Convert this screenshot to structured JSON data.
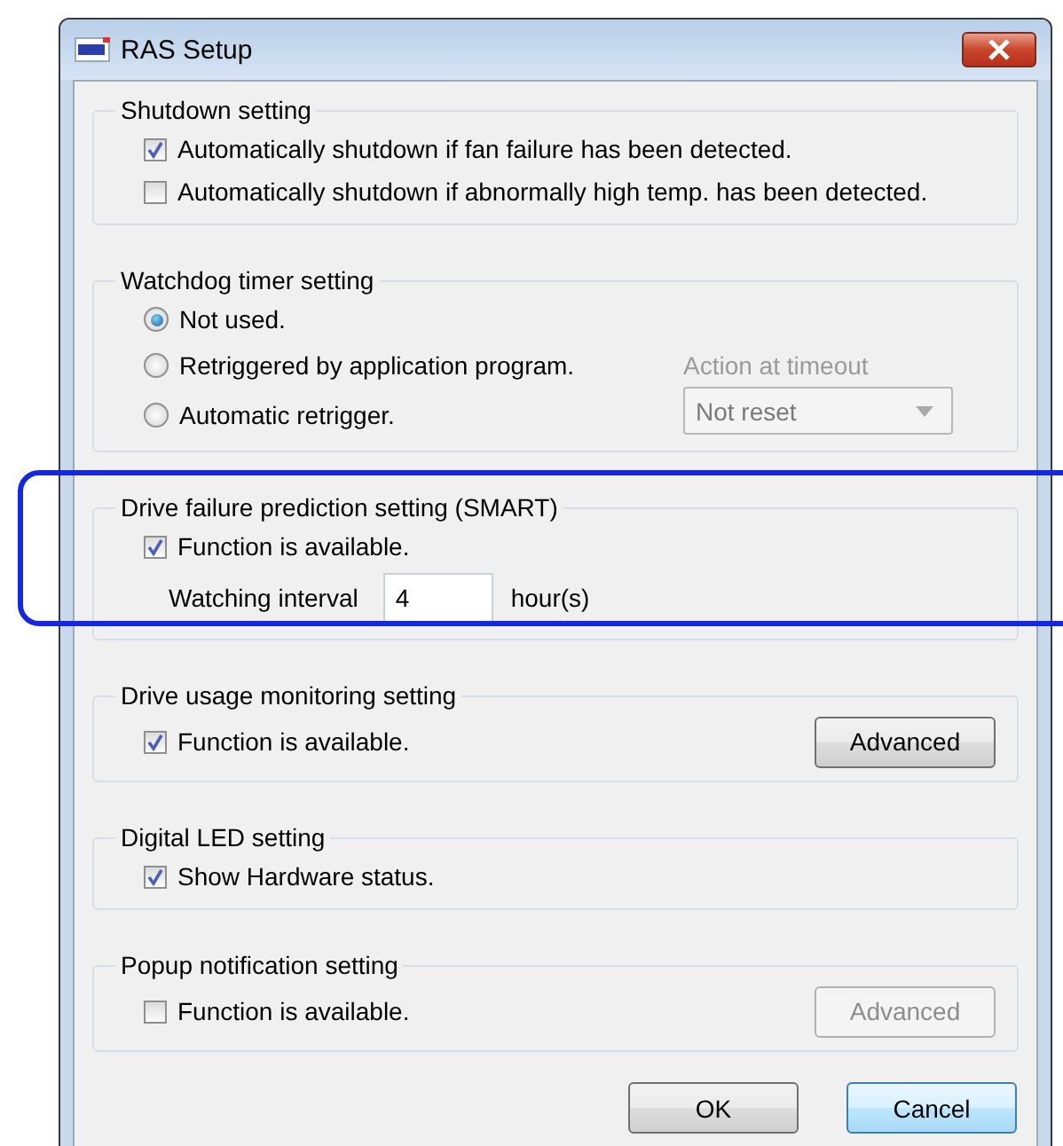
{
  "window": {
    "title": "RAS Setup"
  },
  "shutdown": {
    "title": "Shutdown setting",
    "options": [
      {
        "label": "Automatically shutdown if fan failure has been detected.",
        "checked": true
      },
      {
        "label": "Automatically shutdown if abnormally high temp. has been detected.",
        "checked": false
      }
    ]
  },
  "watchdog": {
    "title": "Watchdog timer setting",
    "options": [
      {
        "label": "Not used.",
        "selected": true
      },
      {
        "label": "Retriggered by application program.",
        "selected": false
      },
      {
        "label": "Automatic retrigger.",
        "selected": false
      }
    ],
    "action": {
      "label": "Action at timeout",
      "value": "Not reset",
      "disabled": true
    }
  },
  "smart": {
    "title": "Drive failure prediction setting (SMART)",
    "function": {
      "label": "Function is available.",
      "checked": true
    },
    "interval": {
      "label": "Watching interval",
      "value": "4",
      "unit": "hour(s)"
    }
  },
  "usage": {
    "title": "Drive usage monitoring setting",
    "function": {
      "label": "Function is available.",
      "checked": true
    },
    "advanced": {
      "label": "Advanced",
      "disabled": false
    }
  },
  "led": {
    "title": "Digital LED setting",
    "option": {
      "label": "Show Hardware status.",
      "checked": true
    }
  },
  "popup": {
    "title": "Popup notification setting",
    "function": {
      "label": "Function is available.",
      "checked": false
    },
    "advanced": {
      "label": "Advanced",
      "disabled": true
    }
  },
  "buttons": [
    {
      "label": "OK",
      "focused": false
    },
    {
      "label": "Cancel",
      "focused": true
    }
  ]
}
